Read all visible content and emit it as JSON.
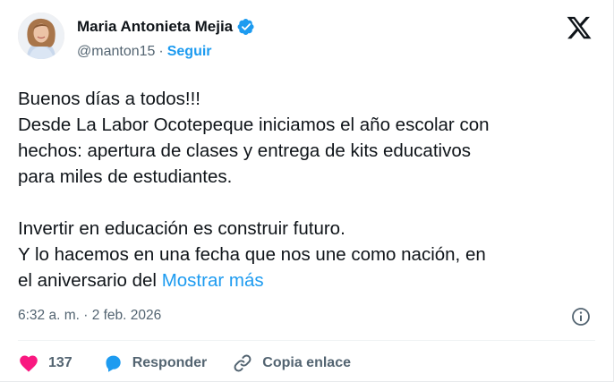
{
  "author": {
    "name": "Maria Antonieta Mejia",
    "handle": "@manton15",
    "separator": "·",
    "follow_label": "Seguir"
  },
  "post": {
    "lines": [
      "Buenos días a todos!!!",
      "Desde La Labor Ocotepeque iniciamos el año escolar con",
      "hechos: apertura de clases y entrega de kits educativos",
      "para miles de estudiantes."
    ],
    "lines2": [
      "Invertir en educación es construir futuro.",
      "Y lo hacemos en una fecha que nos une como nación, en"
    ],
    "last_line": "el aniversario del",
    "show_more": "Mostrar más"
  },
  "timestamp": "6:32 a. m. · 2 feb. 2026",
  "actions": {
    "likes": "137",
    "reply_label": "Responder",
    "copy_label": "Copia enlace"
  },
  "colors": {
    "accent": "#1d9bf0",
    "like": "#f91880",
    "muted": "#536471",
    "text": "#0f1419"
  },
  "icons": [
    "verified-badge-icon",
    "x-logo-icon",
    "info-icon",
    "heart-icon",
    "reply-bubble-icon",
    "link-icon"
  ]
}
